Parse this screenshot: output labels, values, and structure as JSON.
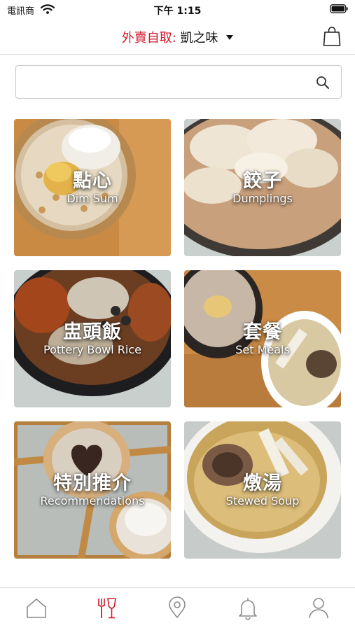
{
  "status_bar": {
    "carrier": "電訊商",
    "time": "下午 1:15"
  },
  "header": {
    "mode_label": "外賣自取:",
    "store_name": "凱之味"
  },
  "search": {
    "value": "",
    "placeholder": ""
  },
  "categories": [
    {
      "zh": "點心",
      "en": "Dim Sum"
    },
    {
      "zh": "餃子",
      "en": "Dumplings"
    },
    {
      "zh": "盅頭飯",
      "en": "Pottery Bowl Rice"
    },
    {
      "zh": "套餐",
      "en": "Set Meals"
    },
    {
      "zh": "特別推介",
      "en": "Recommendations"
    },
    {
      "zh": "燉湯",
      "en": "Stewed Soup"
    }
  ],
  "tab_bar": {
    "items": [
      "home-icon",
      "menu-icon",
      "location-icon",
      "bell-icon",
      "profile-icon"
    ],
    "active": "menu-icon"
  },
  "colors": {
    "accent": "#d4182b",
    "icon_gray": "#8a8a8a",
    "divider": "#d6d6d6"
  }
}
